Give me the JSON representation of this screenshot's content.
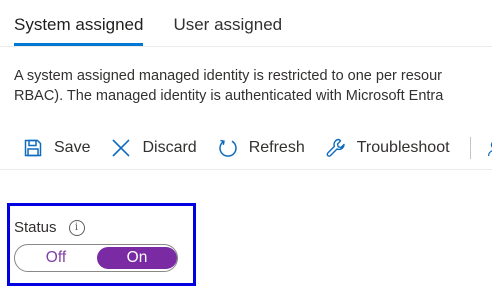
{
  "tabs": [
    {
      "label": "System assigned",
      "active": true
    },
    {
      "label": "User assigned",
      "active": false
    }
  ],
  "description": {
    "line1": "A system assigned managed identity is restricted to one per resour",
    "line2": "RBAC). The managed identity is authenticated with Microsoft Entra"
  },
  "toolbar": {
    "save": {
      "label": "Save",
      "icon": "save-icon"
    },
    "discard": {
      "label": "Discard",
      "icon": "close-icon"
    },
    "refresh": {
      "label": "Refresh",
      "icon": "refresh-icon"
    },
    "troubleshoot": {
      "label": "Troubleshoot",
      "icon": "wrench-icon"
    },
    "overflow_icon": "person-icon"
  },
  "status": {
    "label": "Status",
    "info_icon": "i",
    "toggle": {
      "off_label": "Off",
      "on_label": "On",
      "selected": "On"
    },
    "highlight_color": "#0000e0"
  },
  "colors": {
    "accent": "#0078d4",
    "toggle_on": "#7a2ba4",
    "icon": "#0f6cbd"
  }
}
